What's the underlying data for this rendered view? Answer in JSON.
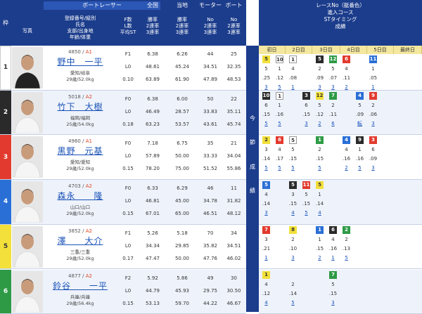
{
  "left_header": {
    "group_title": "ボートレーサー",
    "col_waku": "枠",
    "col_photo": "写真",
    "col_info": [
      "登録番号/級別",
      "氏名",
      "支部/出身地",
      "年齢/体重"
    ],
    "col_stats": [
      "F数",
      "L数",
      "平均ST"
    ],
    "col_zenkoku_title": "全国",
    "col_zenkoku": [
      "勝率",
      "2連率",
      "3連率"
    ],
    "col_touchi_title": "当地",
    "col_touchi": [
      "勝率",
      "2連率",
      "3連率"
    ],
    "col_motor_title": "モーター",
    "col_motor": [
      "No",
      "2連率",
      "3連率"
    ],
    "col_boat_title": "ボート",
    "col_boat": [
      "No",
      "2連率",
      "3連率"
    ]
  },
  "racers": [
    {
      "waku": "1",
      "regno": "4850",
      "cls": "A1",
      "name": "野中　一平",
      "branch": "愛知/岐阜",
      "age": "29歳/52.0kg",
      "f": "F1",
      "l": "L0",
      "st": "0.10",
      "zen": [
        "6.38",
        "48.61",
        "63.89"
      ],
      "touchi": [
        "6.26",
        "45.24",
        "61.90"
      ],
      "motor": [
        "44",
        "34.51",
        "47.89"
      ],
      "boat": [
        "25",
        "32.35",
        "48.53"
      ]
    },
    {
      "waku": "2",
      "regno": "5018",
      "cls": "A2",
      "name": "竹下　大樹",
      "branch": "福岡/福岡",
      "age": "25歳/54.0kg",
      "f": "F0",
      "l": "L0",
      "st": "0.18",
      "zen": [
        "6.38",
        "46.49",
        "63.23"
      ],
      "touchi": [
        "6.00",
        "28.57",
        "53.57"
      ],
      "motor": [
        "50",
        "33.83",
        "43.61"
      ],
      "boat": [
        "22",
        "35.11",
        "45.74"
      ]
    },
    {
      "waku": "3",
      "regno": "4960",
      "cls": "A1",
      "name": "黒野　元基",
      "branch": "愛知/愛知",
      "age": "29歳/52.0kg",
      "f": "F0",
      "l": "L0",
      "st": "0.15",
      "zen": [
        "7.18",
        "57.89",
        "78.20"
      ],
      "touchi": [
        "6.75",
        "50.00",
        "75.00"
      ],
      "motor": [
        "35",
        "33.33",
        "51.52"
      ],
      "boat": [
        "21",
        "34.04",
        "55.86"
      ]
    },
    {
      "waku": "4",
      "regno": "4703",
      "cls": "A2",
      "name": "森永　　隆",
      "branch": "山口/山口",
      "age": "29歳/52.0kg",
      "f": "F0",
      "l": "L0",
      "st": "0.15",
      "zen": [
        "6.33",
        "46.81",
        "67.01"
      ],
      "touchi": [
        "6.29",
        "45.00",
        "65.00"
      ],
      "motor": [
        "46",
        "34.78",
        "46.51"
      ],
      "boat": [
        "11",
        "31.82",
        "48.12"
      ]
    },
    {
      "waku": "5",
      "regno": "3852",
      "cls": "A2",
      "name": "澤　　大介",
      "branch": "三重/三重",
      "age": "29歳/52.0kg",
      "f": "F1",
      "l": "L0",
      "st": "0.17",
      "zen": [
        "5.26",
        "34.34",
        "47.47"
      ],
      "touchi": [
        "5.18",
        "29.85",
        "50.00"
      ],
      "motor": [
        "70",
        "35.82",
        "47.76"
      ],
      "boat": [
        "34",
        "34.51",
        "46.02"
      ]
    },
    {
      "waku": "6",
      "regno": "4877",
      "cls": "A2",
      "name": "鈴谷　　一平",
      "branch": "兵庫/兵庫",
      "age": "29歳/56.4kg",
      "f": "F2",
      "l": "L0",
      "st": "0.15",
      "zen": [
        "5.92",
        "44.79",
        "53.13"
      ],
      "touchi": [
        "5.86",
        "45.93",
        "59.70"
      ],
      "motor": [
        "49",
        "29.75",
        "44.22"
      ],
      "boat": [
        "30",
        "30.50",
        "46.67"
      ]
    }
  ],
  "vertical_label": [
    "今",
    "節",
    "成",
    "績"
  ],
  "right_header": {
    "line1": "レースNo（艇番色）",
    "line2": "進入コース",
    "line3": "STタイミング",
    "line4": "成績",
    "days": [
      "初日",
      "2日目",
      "3日目",
      "4日目",
      "5日目",
      "最終日"
    ]
  },
  "results": [
    {
      "badges": [
        [
          "5",
          "yellow"
        ],
        [
          "10",
          "white"
        ],
        [
          "1",
          "white"
        ],
        [
          "",
          "",
          ""
        ],
        [
          "5",
          "black"
        ],
        [
          "12",
          "green"
        ],
        [
          "6",
          "red"
        ],
        [
          "",
          "",
          ""
        ],
        [
          "11",
          "blue"
        ]
      ],
      "course": [
        "5",
        "1",
        "4",
        "",
        "2",
        "5",
        "4",
        "",
        "1"
      ],
      "st": [
        ".25",
        ".12",
        ".08",
        "",
        ".09",
        ".07",
        ".11",
        "",
        ".05"
      ],
      "rank": [
        "3",
        "5",
        "1",
        "",
        "3",
        "3",
        "2",
        "",
        "1"
      ]
    },
    {
      "badges": [
        [
          "10",
          "black"
        ],
        [
          "1",
          "white"
        ],
        [
          "",
          "",
          ""
        ],
        [
          "3",
          "black"
        ],
        [
          "12",
          "yellow"
        ],
        [
          "7",
          "green"
        ],
        [
          "",
          "",
          ""
        ],
        [
          "4",
          "blue"
        ],
        [
          "9",
          "red"
        ]
      ],
      "course": [
        "6",
        "1",
        "",
        "6",
        "5",
        "2",
        "",
        "5",
        "2"
      ],
      "st": [
        ".15",
        ".16",
        "",
        ".15",
        ".12",
        ".11",
        "",
        ".09",
        ".06"
      ],
      "rank": [
        "5",
        "5",
        "",
        "3",
        "2",
        "6",
        "",
        "転",
        "3"
      ]
    },
    {
      "badges": [
        [
          "2",
          "yellow"
        ],
        [
          "6",
          "red"
        ],
        [
          "5",
          "white"
        ],
        [
          "",
          "",
          ""
        ],
        [
          "1",
          "green"
        ],
        [
          "",
          "",
          ""
        ],
        [
          "4",
          "blue"
        ],
        [
          "9",
          "black"
        ],
        [
          "3",
          "red"
        ]
      ],
      "course": [
        "3",
        "4",
        "5",
        "",
        "2",
        "",
        "4",
        "1",
        "6"
      ],
      "st": [
        ".14",
        ".17",
        ".15",
        "",
        ".15",
        "",
        ".16",
        ".16",
        ".09"
      ],
      "rank": [
        "5",
        "5",
        "5",
        "",
        "5",
        "",
        "2",
        "5",
        "3"
      ]
    },
    {
      "badges": [
        [
          "5",
          "blue"
        ],
        [
          "",
          "",
          ""
        ],
        [
          "5",
          "black"
        ],
        [
          "11",
          "red"
        ],
        [
          "5",
          "yellow"
        ],
        [
          "",
          "",
          ""
        ],
        [
          "",
          "",
          ""
        ],
        [
          "",
          "",
          ""
        ],
        [
          "",
          ""
        ]
      ],
      "course": [
        "4",
        "",
        "3",
        "5",
        "1",
        "",
        "",
        "",
        ""
      ],
      "st": [
        ".14",
        "",
        ".15",
        ".15",
        ".14",
        "",
        "",
        "",
        ""
      ],
      "rank": [
        "3",
        "",
        "4",
        "5",
        "4",
        "",
        "",
        "",
        ""
      ]
    },
    {
      "badges": [
        [
          "7",
          "red"
        ],
        [
          "",
          "",
          ""
        ],
        [
          "8",
          "yellow"
        ],
        [
          "",
          "",
          ""
        ],
        [
          "1",
          "blue"
        ],
        [
          "6",
          "black"
        ],
        [
          "2",
          "green"
        ],
        [
          "",
          "",
          ""
        ],
        [
          "",
          ""
        ]
      ],
      "course": [
        "3",
        "",
        "2",
        "",
        "1",
        "4",
        "2",
        "",
        ""
      ],
      "st": [
        ".21",
        "",
        ".10",
        "",
        ".15",
        ".16",
        ".13",
        "",
        ""
      ],
      "rank": [
        "1",
        "",
        "3",
        "",
        "2",
        "1",
        "5",
        "",
        ""
      ]
    },
    {
      "badges": [
        [
          "1",
          "yellow"
        ],
        [
          "",
          "",
          ""
        ],
        [
          "",
          "",
          ""
        ],
        [
          "",
          "",
          ""
        ],
        [
          "",
          "",
          ""
        ],
        [
          "7",
          "green"
        ],
        [
          "",
          "",
          ""
        ],
        [
          "",
          "",
          ""
        ],
        [
          "",
          ""
        ]
      ],
      "course": [
        "4",
        "",
        "2",
        "",
        "",
        "5",
        "",
        "",
        ""
      ],
      "st": [
        ".12",
        "",
        ".14",
        "",
        "",
        ".15",
        "",
        "",
        ""
      ],
      "rank": [
        "4",
        "",
        "5",
        "",
        "",
        "3",
        "",
        "",
        ""
      ]
    }
  ]
}
